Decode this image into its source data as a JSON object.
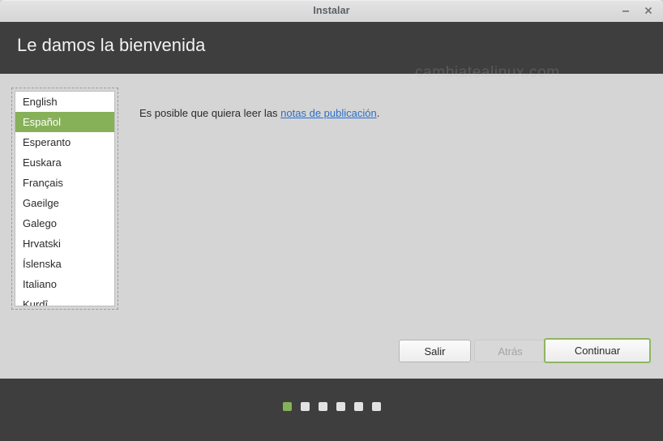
{
  "window": {
    "title": "Instalar",
    "controls": [
      {
        "name": "minimize-button",
        "glyph": "minimize"
      },
      {
        "name": "close-button",
        "glyph": "close"
      }
    ]
  },
  "header": {
    "title": "Le damos la bienvenida",
    "watermark": "cambiatealinux.com"
  },
  "language_list": {
    "items": [
      {
        "label": "English",
        "selected": false
      },
      {
        "label": "Español",
        "selected": true
      },
      {
        "label": "Esperanto",
        "selected": false
      },
      {
        "label": "Euskara",
        "selected": false
      },
      {
        "label": "Français",
        "selected": false
      },
      {
        "label": "Gaeilge",
        "selected": false
      },
      {
        "label": "Galego",
        "selected": false
      },
      {
        "label": "Hrvatski",
        "selected": false
      },
      {
        "label": "Íslenska",
        "selected": false
      },
      {
        "label": "Italiano",
        "selected": false
      },
      {
        "label": "Kurdî",
        "selected": false
      }
    ]
  },
  "main": {
    "notes_prefix": "Es posible que quiera leer las ",
    "notes_link": "notas de publicación",
    "notes_suffix": "."
  },
  "buttons": {
    "quit": "Salir",
    "back": "Atrás",
    "next": "Continuar"
  },
  "progress": {
    "total": 6,
    "current": 1,
    "steps": [
      {
        "active": true
      },
      {
        "active": false
      },
      {
        "active": false
      },
      {
        "active": false
      },
      {
        "active": false
      },
      {
        "active": false
      }
    ]
  },
  "colors": {
    "accent_green": "#87b158",
    "header_dark": "#3e3e3e",
    "body_grey": "#d5d5d5",
    "link_blue": "#2a6fc9"
  }
}
